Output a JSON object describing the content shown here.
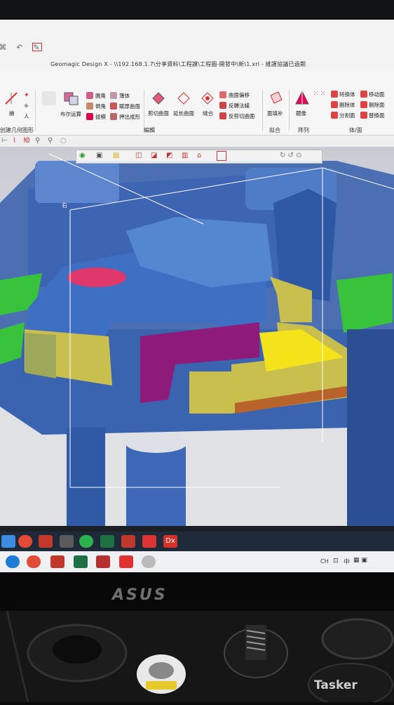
{
  "window": {
    "title": "Geomagic Design X - \\\\192.168.1.7\\分享資料\\工程課\\工程圖-開發中\\新\\1.xrl - 維護協議已過期"
  },
  "ribbon": {
    "left_items": [
      "繪",
      "人"
    ],
    "split_label": "布尔运算",
    "col1": [
      "圓角",
      "倒角",
      "拔模"
    ],
    "col2": [
      "薄体",
      "賦厚曲面",
      "押出成形"
    ],
    "surface_tools": [
      "剪切曲面",
      "延长曲面",
      "縫合"
    ],
    "col3": [
      "曲面偏移",
      "反轉法線",
      "反剪切曲面"
    ],
    "fill_label": "面填补",
    "mirror_label": "鏡像",
    "body_col1": [
      "转換体",
      "刪除体",
      "分割面"
    ],
    "body_col2": [
      "移动面",
      "刪除面",
      "替換面"
    ],
    "groups": [
      "创建几何图形",
      "編輯",
      "拟合",
      "阵列",
      "体/面"
    ]
  },
  "viewport": {
    "label": "右",
    "colors": {
      "mesh_blue": "#3f6fc2",
      "yellow_band": "#c9bf4e",
      "magenta": "#8e1a7a",
      "green": "#39c23c",
      "pink_dot": "#e0386a",
      "bright_yellow": "#f4e31a"
    }
  },
  "taskbar": {
    "apps_row1": [
      "chrome-icon",
      "excel-icon",
      "app-icon",
      "flash-icon",
      "dx-icon"
    ],
    "dx_label": "Dx",
    "apps_row2": [
      "edge-icon",
      "chrome-icon",
      "excel-icon",
      "app-icon",
      "flash-icon",
      "mouse-icon"
    ],
    "tray_lang": "CH",
    "tray_ime": "中"
  },
  "monitor": {
    "brand": "ASUS"
  },
  "watermark": "Tasker"
}
